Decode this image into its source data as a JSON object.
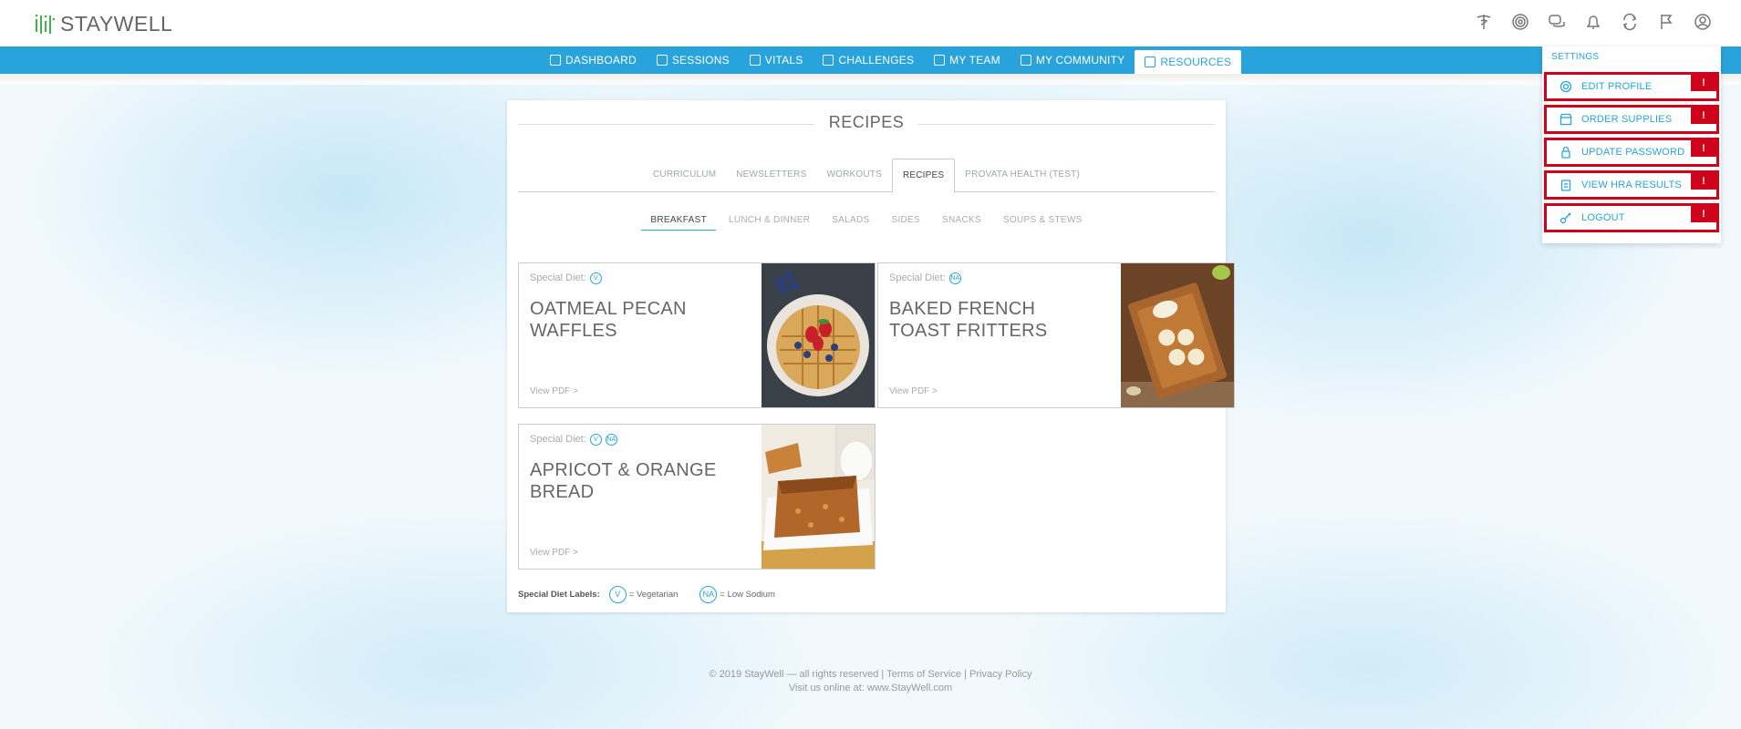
{
  "brand": {
    "logo_text": "STAYWELL"
  },
  "top_icons": [
    "caduceus-icon",
    "broadcast-icon",
    "chat-icon",
    "bell-icon",
    "sync-icon",
    "flag-icon",
    "user-icon"
  ],
  "nav": {
    "items": [
      {
        "label": "DASHBOARD",
        "icon": "home-icon"
      },
      {
        "label": "SESSIONS",
        "icon": "calendar-icon"
      },
      {
        "label": "VITALS",
        "icon": "heart-icon"
      },
      {
        "label": "CHALLENGES",
        "icon": "chart-icon"
      },
      {
        "label": "MY TEAM",
        "icon": "team-icon"
      },
      {
        "label": "MY COMMUNITY",
        "icon": "globe-icon"
      },
      {
        "label": "RESOURCES",
        "icon": "resources-icon"
      }
    ],
    "active": "RESOURCES"
  },
  "main": {
    "title": "RECIPES",
    "tabs": [
      "CURRICULUM",
      "NEWSLETTERS",
      "WORKOUTS",
      "RECIPES",
      "PROVATA HEALTH (TEST)"
    ],
    "active_tab": "RECIPES",
    "subtabs": [
      "BREAKFAST",
      "LUNCH & DINNER",
      "SALADS",
      "SIDES",
      "SNACKS",
      "SOUPS & STEWS"
    ],
    "active_subtab": "BREAKFAST",
    "recipes": [
      {
        "diet_label": "Special Diet:",
        "badges": [
          "V"
        ],
        "title": "OATMEAL PECAN WAFFLES",
        "link": "View PDF >"
      },
      {
        "diet_label": "Special Diet:",
        "badges": [
          "NA"
        ],
        "title": "BAKED FRENCH TOAST FRITTERS",
        "link": "View PDF >"
      },
      {
        "diet_label": "Special Diet:",
        "badges": [
          "V",
          "NA"
        ],
        "title": "APRICOT & ORANGE BREAD",
        "link": "View PDF >"
      }
    ],
    "legend": {
      "label": "Special Diet Labels:",
      "items": [
        {
          "badge": "V",
          "text": "= Vegetarian"
        },
        {
          "badge": "NA",
          "text": "= Low Sodium"
        }
      ]
    }
  },
  "footer": {
    "copyright": "© 2019 StayWell — all rights reserved",
    "sep": "|",
    "terms": "Terms of Service",
    "privacy": "Privacy Policy",
    "visit": "Visit us online at: www.StayWell.com"
  },
  "settings": {
    "header": "SETTINGS",
    "items": [
      {
        "label": "EDIT PROFILE",
        "icon": "gear-icon",
        "alert": "!"
      },
      {
        "label": "ORDER SUPPLIES",
        "icon": "store-icon",
        "alert": "!"
      },
      {
        "label": "UPDATE PASSWORD",
        "icon": "lock-icon",
        "alert": "!"
      },
      {
        "label": "VIEW HRA RESULTS",
        "icon": "clipboard-icon",
        "alert": "!"
      },
      {
        "label": "LOGOUT",
        "icon": "logout-icon",
        "alert": "!"
      }
    ]
  }
}
